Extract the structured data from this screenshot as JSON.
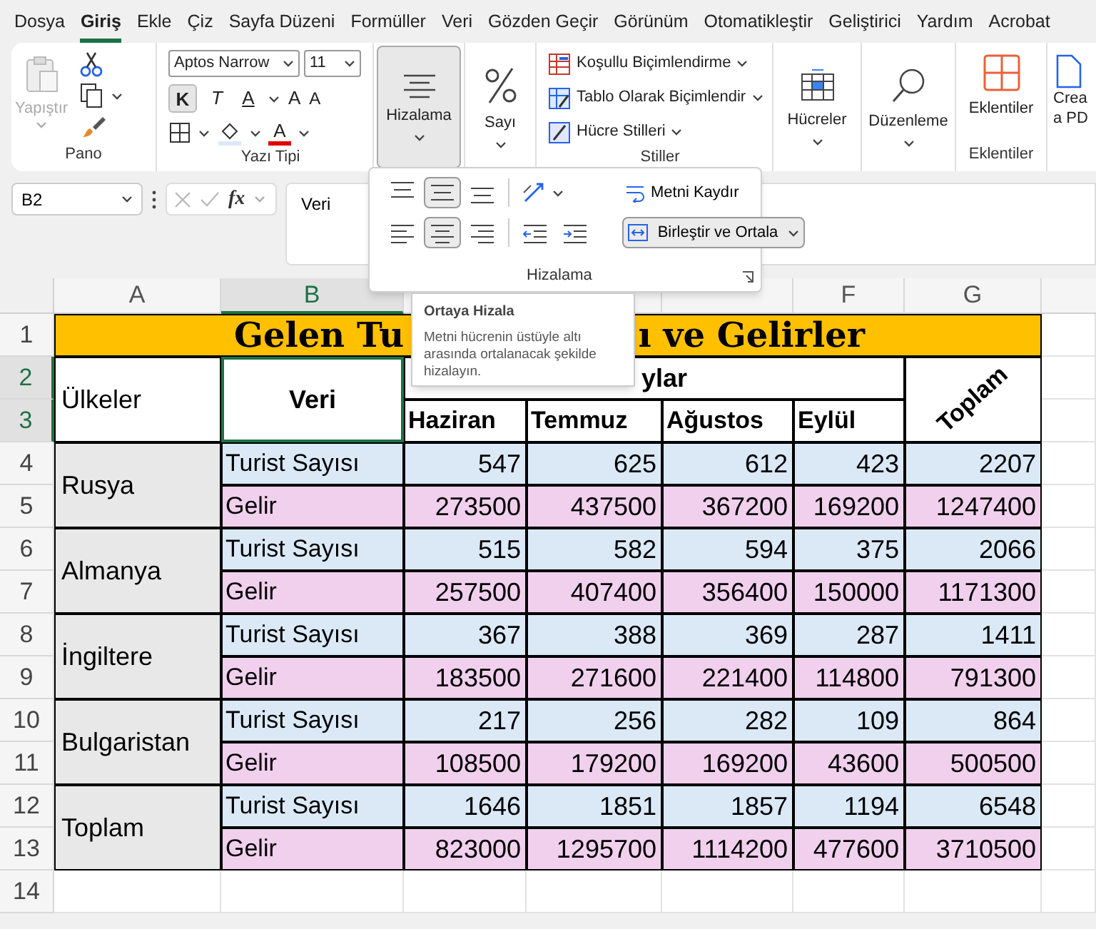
{
  "menu_tabs": [
    {
      "label": "Dosya",
      "selected": false
    },
    {
      "label": "Giriş",
      "selected": true
    },
    {
      "label": "Ekle",
      "selected": false
    },
    {
      "label": "Çiz",
      "selected": false
    },
    {
      "label": "Sayfa Düzeni",
      "selected": false
    },
    {
      "label": "Formüller",
      "selected": false
    },
    {
      "label": "Veri",
      "selected": false
    },
    {
      "label": "Gözden Geçir",
      "selected": false
    },
    {
      "label": "Görünüm",
      "selected": false
    },
    {
      "label": "Otomatikleştir",
      "selected": false
    },
    {
      "label": "Geliştirici",
      "selected": false
    },
    {
      "label": "Yardım",
      "selected": false
    },
    {
      "label": "Acrobat",
      "selected": false
    }
  ],
  "ribbon": {
    "clipboard": {
      "paste_label": "Yapıştır",
      "paste_disabled": true,
      "group_label": "Pano"
    },
    "font": {
      "family": "Aptos Narrow",
      "size": "11",
      "bold": "K",
      "italic": "T",
      "underline": "A",
      "grow": "A",
      "shrink": "A",
      "font_color": "A",
      "group_label": "Yazı Tipi"
    },
    "big_buttons": [
      {
        "kind": "align",
        "label": "Hizalama",
        "selected": true
      },
      {
        "kind": "number",
        "label": "Sayı",
        "selected": false
      }
    ],
    "styles": {
      "items": [
        "Koşullu Biçimlendirme",
        "Tablo Olarak Biçimlendir",
        "Hücre Stilleri"
      ],
      "group_label": "Stiller"
    },
    "more_buttons": [
      {
        "kind": "cells",
        "label": "Hücreler",
        "selected": false
      },
      {
        "kind": "editing",
        "label": "Düzenleme",
        "selected": false
      }
    ],
    "addins": {
      "label": "Eklentiler",
      "group_label": "Eklentiler"
    },
    "cut_button": {
      "lines": [
        "Crea",
        "a PD"
      ]
    }
  },
  "formula_bar": {
    "name_box": "B2",
    "function_label": "fx",
    "content": "Veri"
  },
  "alignment_panel": {
    "buttons": [
      {
        "kind": "top",
        "selected": false
      },
      {
        "kind": "middle",
        "selected": true
      },
      {
        "kind": "bottom",
        "selected": false
      },
      {
        "kind": "orientation",
        "selected": false
      },
      {
        "kind": "left",
        "selected": false
      },
      {
        "kind": "center",
        "selected": true
      },
      {
        "kind": "right",
        "selected": false
      },
      {
        "kind": "outdent",
        "selected": false
      },
      {
        "kind": "indent",
        "selected": false
      }
    ],
    "wrap_text": "Metni Kaydır",
    "merge": "Birleştir ve Ortala",
    "group_label": "Hizalama"
  },
  "tooltip": {
    "title": "Ortaya Hizala",
    "body": "Metni hücrenin üstüyle altı arasında ortalanacak şekilde hizalayın."
  },
  "sheet": {
    "columns": [
      {
        "header": "A",
        "selected": false
      },
      {
        "header": "B",
        "selected": true
      },
      {
        "selected": false
      },
      {
        "selected": false
      },
      {
        "selected": false
      },
      {
        "header": "F",
        "selected": false
      },
      {
        "header": "G",
        "selected": false
      }
    ],
    "rows": [
      {
        "number": "1",
        "selected": false
      },
      {
        "number": "2",
        "selected": true
      },
      {
        "number": "3",
        "selected": true
      },
      {
        "number": "4",
        "selected": false
      },
      {
        "number": "5",
        "selected": false
      },
      {
        "number": "6",
        "selected": false
      },
      {
        "number": "7",
        "selected": false
      },
      {
        "number": "8",
        "selected": false
      },
      {
        "number": "9",
        "selected": false
      },
      {
        "number": "10",
        "selected": false
      },
      {
        "number": "11",
        "selected": false
      },
      {
        "number": "12",
        "selected": false
      },
      {
        "number": "13",
        "selected": false
      },
      {
        "number": "14",
        "selected": false
      }
    ],
    "title_parts": [
      "Gelen Tu",
      "ı ve Gelirler"
    ],
    "header": {
      "countries": "Ülkeler",
      "data": "Veri",
      "months_group": "ylar",
      "months": [
        "Haziran",
        "Temmuz",
        "Ağustos",
        "Eylül"
      ],
      "total": "Toplam"
    },
    "countries": [
      {
        "name": "Rusya",
        "rows": [
          {
            "kind": "tourists",
            "label": "Turist Sayısı",
            "values": [
              "547",
              "625",
              "612",
              "423"
            ],
            "total": "2207"
          },
          {
            "kind": "income",
            "label": "Gelir",
            "values": [
              "273500",
              "437500",
              "367200",
              "169200"
            ],
            "total": "1247400"
          }
        ]
      },
      {
        "name": "Almanya",
        "rows": [
          {
            "kind": "tourists",
            "label": "Turist Sayısı",
            "values": [
              "515",
              "582",
              "594",
              "375"
            ],
            "total": "2066"
          },
          {
            "kind": "income",
            "label": "Gelir",
            "values": [
              "257500",
              "407400",
              "356400",
              "150000"
            ],
            "total": "1171300"
          }
        ]
      },
      {
        "name": "İngiltere",
        "rows": [
          {
            "kind": "tourists",
            "label": "Turist Sayısı",
            "values": [
              "367",
              "388",
              "369",
              "287"
            ],
            "total": "1411"
          },
          {
            "kind": "income",
            "label": "Gelir",
            "values": [
              "183500",
              "271600",
              "221400",
              "114800"
            ],
            "total": "791300"
          }
        ]
      },
      {
        "name": "Bulgaristan",
        "rows": [
          {
            "kind": "tourists",
            "label": "Turist Sayısı",
            "values": [
              "217",
              "256",
              "282",
              "109"
            ],
            "total": "864"
          },
          {
            "kind": "income",
            "label": "Gelir",
            "values": [
              "108500",
              "179200",
              "169200",
              "43600"
            ],
            "total": "500500"
          }
        ]
      },
      {
        "name": "Toplam",
        "rows": [
          {
            "kind": "tourists",
            "label": "Turist Sayısı",
            "values": [
              "1646",
              "1851",
              "1857",
              "1194"
            ],
            "total": "6548"
          },
          {
            "kind": "income",
            "label": "Gelir",
            "values": [
              "823000",
              "1295700",
              "1114200",
              "477600"
            ],
            "total": "3710500"
          }
        ]
      }
    ]
  }
}
